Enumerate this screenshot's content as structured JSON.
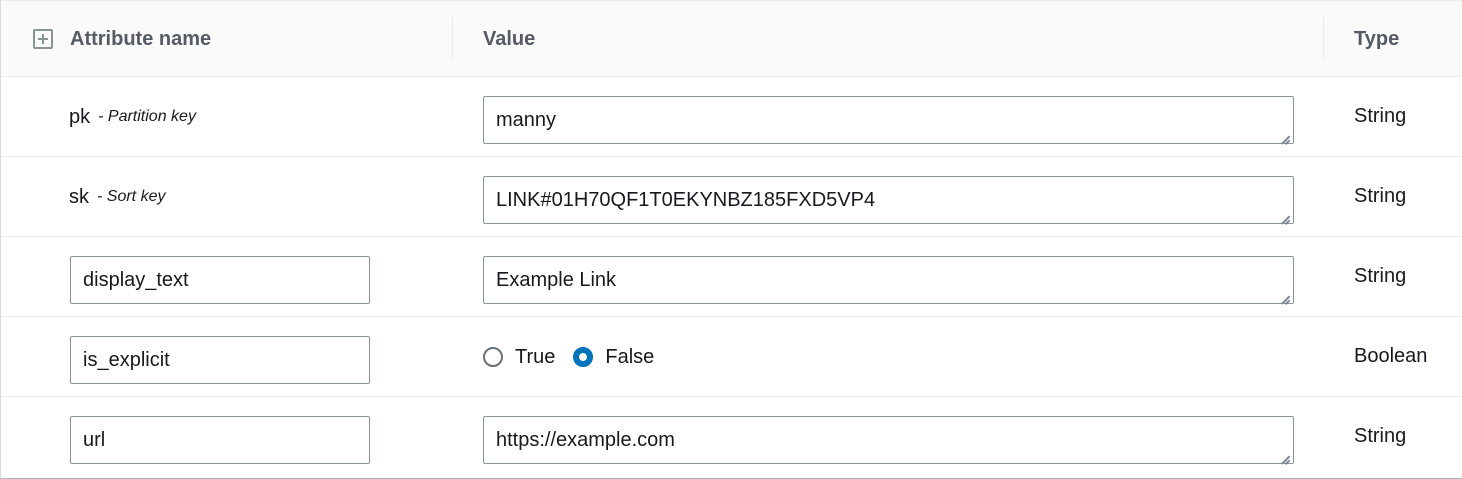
{
  "header": {
    "attribute_name": "Attribute name",
    "value": "Value",
    "type": "Type"
  },
  "rows": [
    {
      "key": "pk",
      "hint": "- Partition key",
      "value": "manny",
      "type": "String"
    },
    {
      "key": "sk",
      "hint": "- Sort key",
      "value": "LINK#01H70QF1T0EKYNBZ185FXD5VP4",
      "type": "String"
    },
    {
      "name": "display_text",
      "value": "Example Link",
      "type": "String"
    },
    {
      "name": "is_explicit",
      "radio_true": "True",
      "radio_false": "False",
      "selected": "False",
      "type": "Boolean"
    },
    {
      "name": "url",
      "value": "https://example.com",
      "type": "String"
    }
  ],
  "colors": {
    "header_bg": "#fafafa",
    "border": "#879596",
    "radio_selected": "#0073bb"
  },
  "icons": {
    "expand": "plus-square-icon",
    "resize": "resize-handle-icon"
  }
}
